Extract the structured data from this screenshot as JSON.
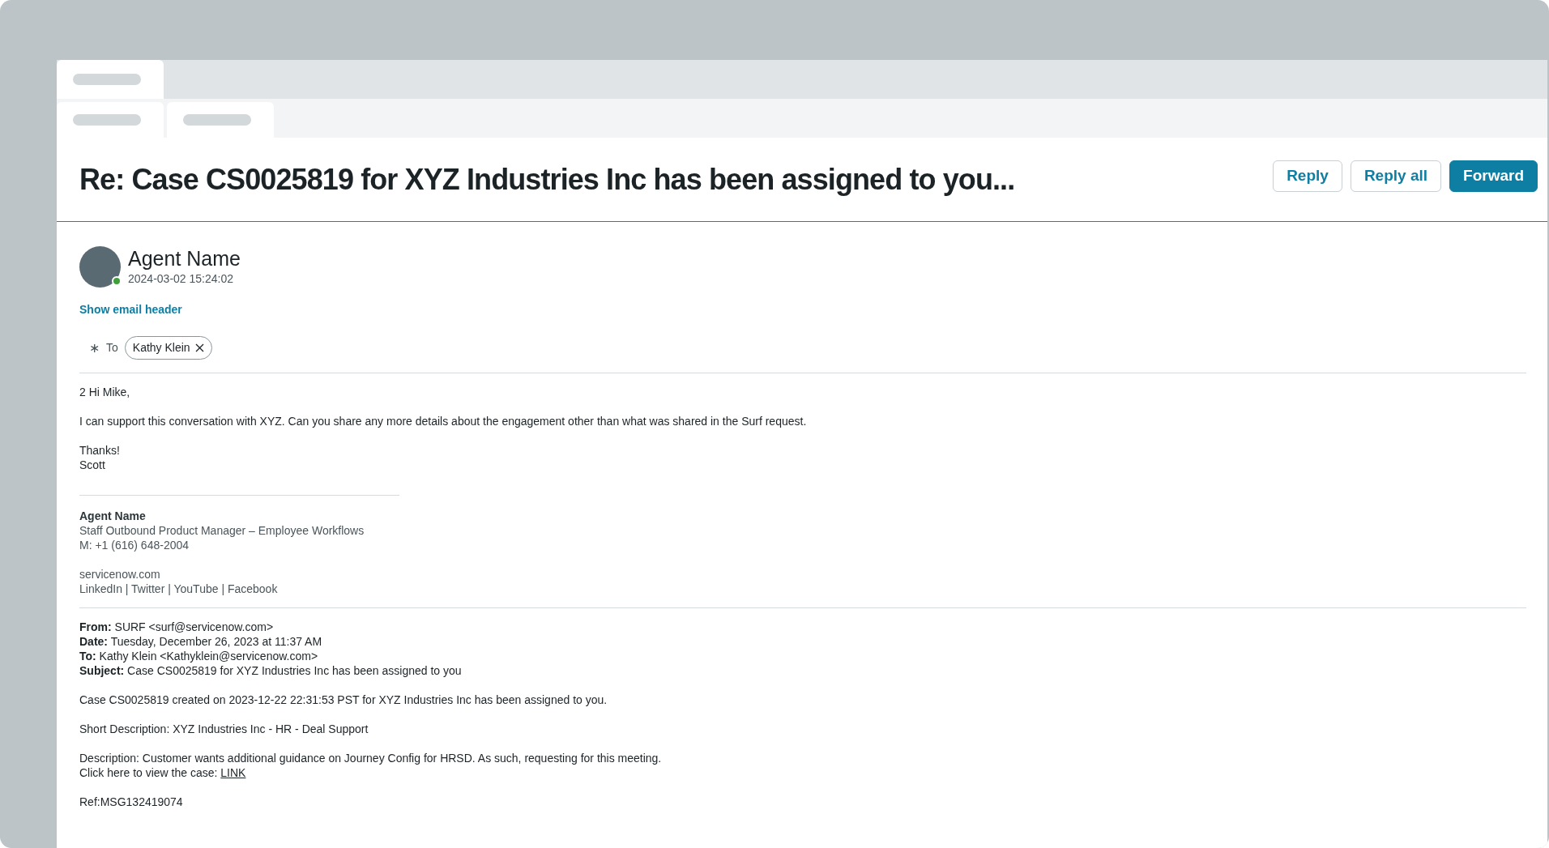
{
  "title": "Re: Case CS0025819 for XYZ Industries Inc has been assigned to you...",
  "actions": [
    {
      "label": "Reply",
      "kind": "secondary"
    },
    {
      "label": "Reply all",
      "kind": "secondary"
    },
    {
      "label": "Forward",
      "kind": "primary"
    }
  ],
  "sender": {
    "name": "Agent Name",
    "timestamp": "2024-03-02 15:24:02",
    "online": true
  },
  "show_header_link": "Show email header",
  "recipients": {
    "required_mark": "∗",
    "label": "To",
    "chips": [
      "Kathy Klein"
    ]
  },
  "body": {
    "paragraphs": [
      [
        "2 Hi Mike,"
      ],
      [
        "I can support this conversation with XYZ. Can you share any more details about the engagement other than what was shared in the Surf request."
      ],
      [
        "Thanks!",
        "Scott"
      ]
    ]
  },
  "signature": {
    "name": "Agent Name",
    "lines": [
      [
        "Staff Outbound Product Manager – Employee Workflows",
        "M: +1 (616) 648-2004"
      ],
      [
        "servicenow.com",
        "LinkedIn | Twitter | YouTube | Facebook"
      ]
    ]
  },
  "quoted": {
    "header": [
      "**From:** SURF <surf@servicenow.com>",
      "**Date:** Tuesday, December 26, 2023 at 11:37 AM",
      "**To:** Kathy Klein <Kathyklein@servicenow.com>",
      "**Subject:** Case CS0025819 for XYZ Industries Inc has been assigned to you"
    ],
    "paragraphs": [
      [
        "Case CS0025819 created on 2023-12-22 22:31:53 PST for XYZ Industries Inc has been assigned to you."
      ],
      [
        "Short Description: XYZ Industries Inc - HR - Deal Support"
      ],
      [
        "Description: Customer wants additional guidance on Journey Config for HRSD. As such, requesting for this meeting."
      ]
    ],
    "link_line": {
      "text": "Click here to view the case:",
      "link": "LINK"
    },
    "ref": "Ref:MSG132419074"
  }
}
